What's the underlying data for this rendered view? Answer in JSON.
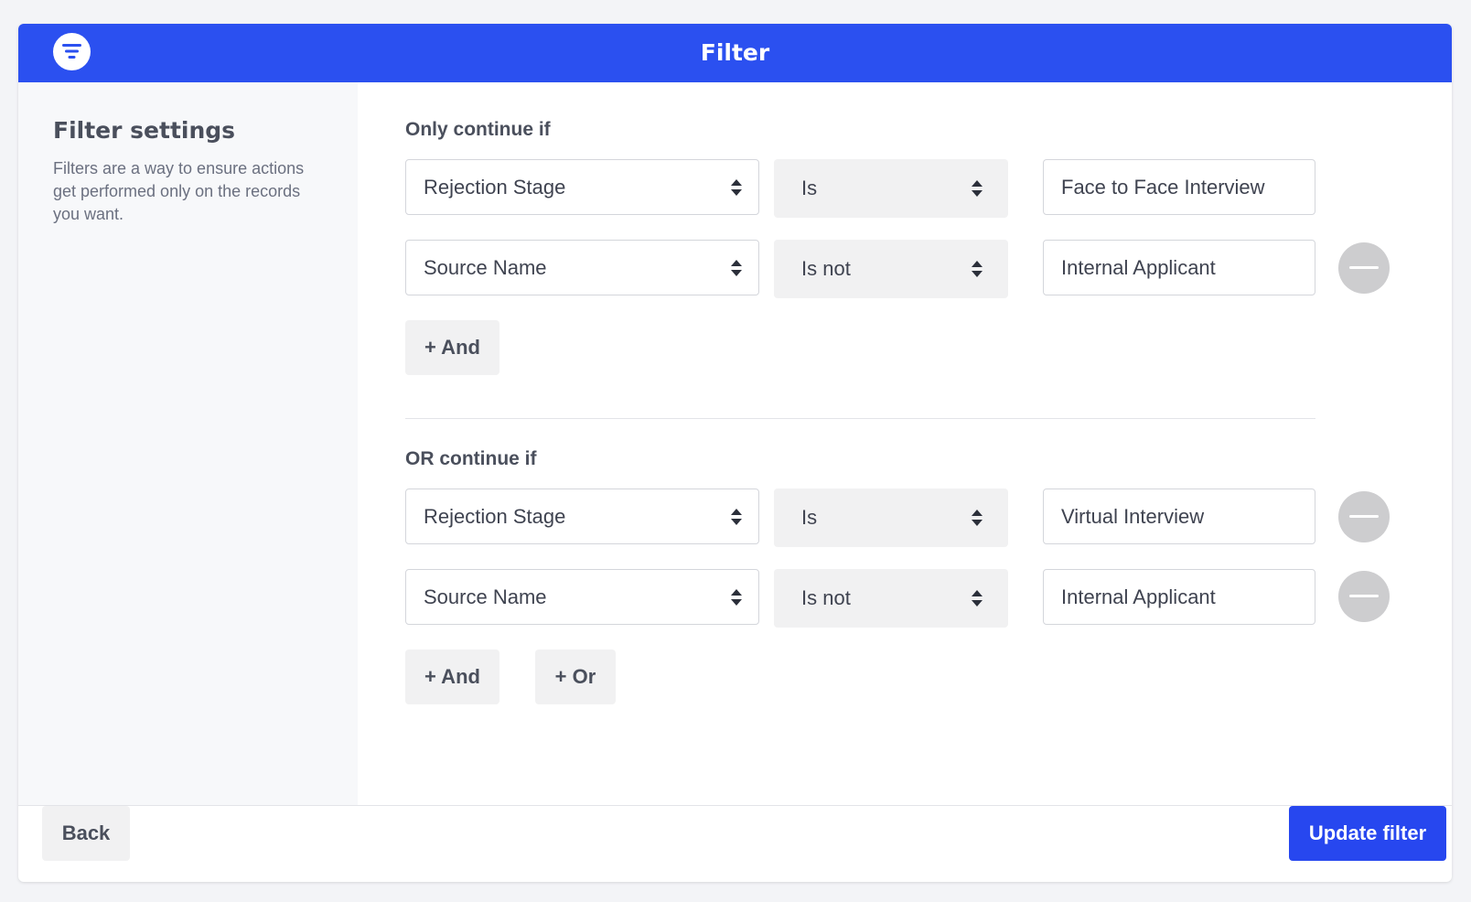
{
  "header": {
    "title": "Filter",
    "icon": "filter-icon",
    "color": "#2b50f0"
  },
  "sidebar": {
    "title": "Filter settings",
    "description": "Filters are a way to ensure actions get performed only on the records you want."
  },
  "groups": [
    {
      "label": "Only continue if",
      "conditions": [
        {
          "field": "Rejection Stage",
          "operator": "Is",
          "value": "Face to Face Interview",
          "removable": false
        },
        {
          "field": "Source Name",
          "operator": "Is not",
          "value": "Internal Applicant",
          "removable": true
        }
      ],
      "buttons": [
        "+ And"
      ]
    },
    {
      "label": "OR continue if",
      "conditions": [
        {
          "field": "Rejection Stage",
          "operator": "Is",
          "value": "Virtual Interview",
          "removable": true
        },
        {
          "field": "Source Name",
          "operator": "Is not",
          "value": "Internal Applicant",
          "removable": true
        }
      ],
      "buttons": [
        "+ And",
        "+ Or"
      ]
    }
  ],
  "footer": {
    "back_label": "Back",
    "update_label": "Update filter",
    "update_color": "#2747ef"
  }
}
